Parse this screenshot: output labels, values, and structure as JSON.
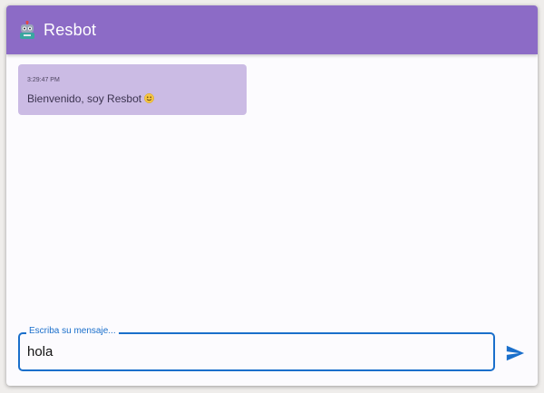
{
  "app": {
    "title": "Resbot",
    "bot_icon": "robot-icon",
    "accent_color": "#8c6bc6",
    "input_accent_color": "#1a6fcb"
  },
  "messages": [
    {
      "time": "3:29:47 PM",
      "text": "Bienvenido, soy Resbot",
      "emoji_icon": "smiling-face-icon",
      "bubble_color": "#cbbbe4"
    }
  ],
  "composer": {
    "label": "Escriba su mensaje...",
    "value": "hola",
    "send_icon": "send-icon"
  }
}
